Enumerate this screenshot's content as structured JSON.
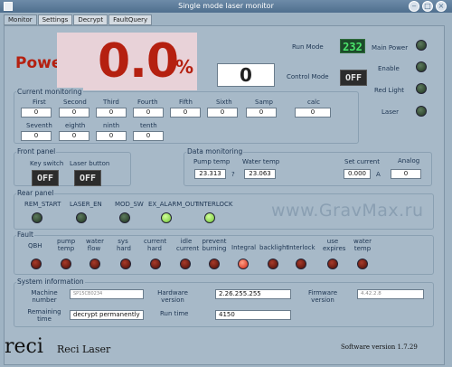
{
  "window": {
    "title": "Single mode laser monitor"
  },
  "tabs": [
    "Monitor",
    "Settings",
    "Decrypt",
    "FaultQuery"
  ],
  "power": {
    "label": "Power",
    "value": "0.0",
    "unit": "%"
  },
  "control_mode": {
    "value": "0",
    "label": "Control Mode",
    "switch": "OFF"
  },
  "run_mode": {
    "label": "Run Mode",
    "value": "232"
  },
  "status_leds": {
    "main_power": "Main Power",
    "enable": "Enable",
    "red_light": "Red Light",
    "laser": "Laser"
  },
  "current_monitoring": {
    "title": "Current monitoring",
    "row1_labels": [
      "First",
      "Second",
      "Third",
      "Fourth",
      "Fifth",
      "Sixth",
      "Samp",
      "calc"
    ],
    "row1_values": [
      "0",
      "0",
      "0",
      "0",
      "0",
      "0",
      "0",
      "0"
    ],
    "row2_labels": [
      "Seventh",
      "eighth",
      "ninth",
      "tenth"
    ],
    "row2_values": [
      "0",
      "0",
      "0",
      "0"
    ]
  },
  "front_panel": {
    "title": "Front panel",
    "key_switch": "Key switch",
    "laser_button": "Laser button",
    "key_state": "OFF",
    "button_state": "OFF"
  },
  "data_monitoring": {
    "title": "Data monitoring",
    "pump_temp_label": "Pump temp",
    "pump_temp": "23.313",
    "separator": "?",
    "water_temp_label": "Water temp",
    "water_temp": "23.063",
    "set_current_label": "Set current",
    "set_current": "0.000",
    "set_current_unit": "A",
    "analog_label": "Analog",
    "analog": "0"
  },
  "rear_panel": {
    "title": "Rear panel",
    "items": [
      "REM_START",
      "LASER_EN",
      "MOD_SW",
      "EX_ALARM_OUT",
      "INTERLOCK"
    ],
    "states": [
      "off",
      "off",
      "off",
      "on",
      "on"
    ]
  },
  "fault": {
    "title": "Fault",
    "items": [
      "QBH",
      "pump temp",
      "water flow",
      "sys hard",
      "current hard",
      "idle current",
      "prevent burning",
      "Integral",
      "backlight",
      "Interlock",
      "use expires",
      "water temp"
    ],
    "states": [
      "off",
      "off",
      "off",
      "off",
      "off",
      "off",
      "off",
      "on",
      "off",
      "off",
      "off",
      "off"
    ]
  },
  "system_information": {
    "title": "System information",
    "machine_number_label": "Machine number",
    "machine_number": "SP15CB0234",
    "hardware_version_label": "Hardware version",
    "hardware_version": "2.26.255.255",
    "firmware_version_label": "Firmware version",
    "firmware_version": "4.42.2.8",
    "remaining_time_label": "Remaining time",
    "remaining_time": "decrypt permanently",
    "run_time_label": "Run time",
    "run_time": "4150"
  },
  "branding": {
    "logo": "reci",
    "name": "Reci Laser",
    "software_version": "Software version  1.7.29"
  },
  "watermark": "www.GravMax.ru",
  "colors": {
    "accent_red": "#b52010",
    "led_on": "#8ee04a",
    "led_fault_on": "#e23a1c"
  }
}
